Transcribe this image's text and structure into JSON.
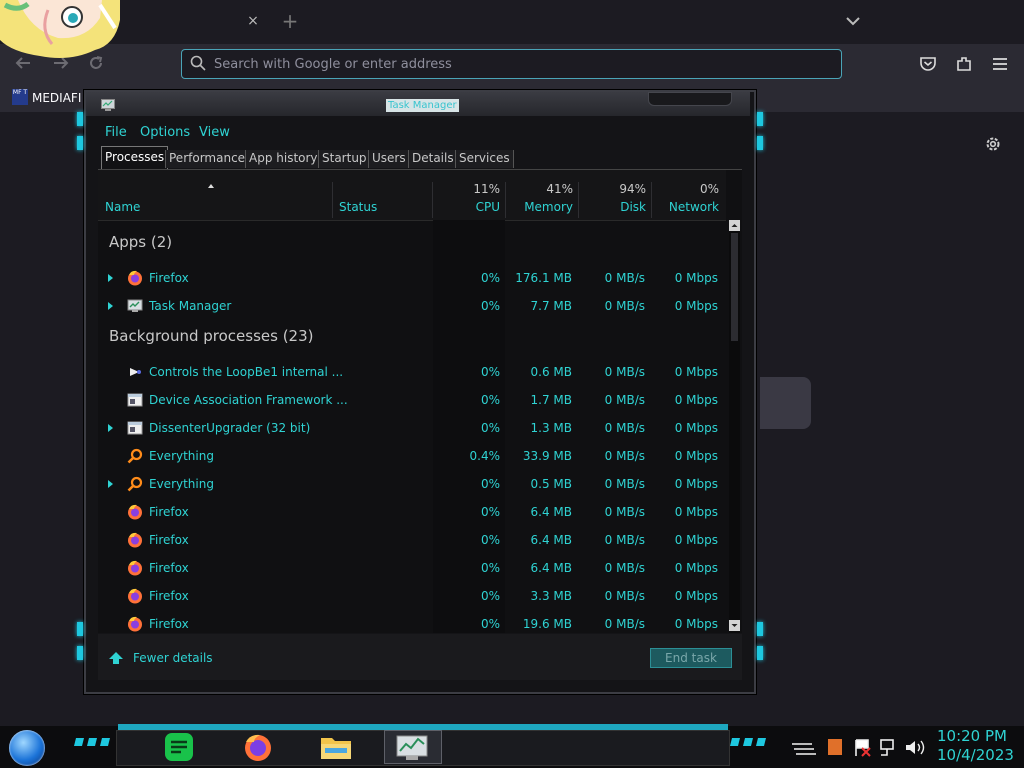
{
  "browser": {
    "tab_close_glyph": "×",
    "new_tab_glyph": "+",
    "url_placeholder": "Search with Google or enter address",
    "bookmark_label": "MEDIAFI",
    "bookmark_icon_text": "MF T"
  },
  "task_manager": {
    "title": "Task Manager",
    "menu": [
      "File",
      "Options",
      "View"
    ],
    "tabs": [
      "Processes",
      "Performance",
      "App history",
      "Startup",
      "Users",
      "Details",
      "Services"
    ],
    "active_tab": "Processes",
    "columns": {
      "name": "Name",
      "status": "Status",
      "cpu": {
        "label": "CPU",
        "pct": "11%"
      },
      "memory": {
        "label": "Memory",
        "pct": "41%"
      },
      "disk": {
        "label": "Disk",
        "pct": "94%"
      },
      "network": {
        "label": "Network",
        "pct": "0%"
      }
    },
    "groups": {
      "apps": "Apps (2)",
      "background": "Background processes (23)"
    },
    "rows": [
      {
        "name": "Firefox",
        "cpu": "0%",
        "memory": "176.1 MB",
        "disk": "0 MB/s",
        "network": "0 Mbps",
        "expandable": true,
        "icon": "firefox-icon"
      },
      {
        "name": "Task Manager",
        "cpu": "0%",
        "memory": "7.7 MB",
        "disk": "0 MB/s",
        "network": "0 Mbps",
        "expandable": true,
        "icon": "task-manager-icon"
      },
      {
        "name": "Controls the LoopBe1 internal ...",
        "cpu": "0%",
        "memory": "0.6 MB",
        "disk": "0 MB/s",
        "network": "0 Mbps",
        "expandable": false,
        "icon": "loopbe-icon"
      },
      {
        "name": "Device Association Framework ...",
        "cpu": "0%",
        "memory": "1.7 MB",
        "disk": "0 MB/s",
        "network": "0 Mbps",
        "expandable": false,
        "icon": "service-window-icon"
      },
      {
        "name": "DissenterUpgrader (32 bit)",
        "cpu": "0%",
        "memory": "1.3 MB",
        "disk": "0 MB/s",
        "network": "0 Mbps",
        "expandable": true,
        "icon": "service-window-icon"
      },
      {
        "name": "Everything",
        "cpu": "0.4%",
        "memory": "33.9 MB",
        "disk": "0 MB/s",
        "network": "0 Mbps",
        "expandable": false,
        "icon": "magnifier-icon"
      },
      {
        "name": "Everything",
        "cpu": "0%",
        "memory": "0.5 MB",
        "disk": "0 MB/s",
        "network": "0 Mbps",
        "expandable": true,
        "icon": "magnifier-icon"
      },
      {
        "name": "Firefox",
        "cpu": "0%",
        "memory": "6.4 MB",
        "disk": "0 MB/s",
        "network": "0 Mbps",
        "expandable": false,
        "icon": "firefox-icon"
      },
      {
        "name": "Firefox",
        "cpu": "0%",
        "memory": "6.4 MB",
        "disk": "0 MB/s",
        "network": "0 Mbps",
        "expandable": false,
        "icon": "firefox-icon"
      },
      {
        "name": "Firefox",
        "cpu": "0%",
        "memory": "6.4 MB",
        "disk": "0 MB/s",
        "network": "0 Mbps",
        "expandable": false,
        "icon": "firefox-icon"
      },
      {
        "name": "Firefox",
        "cpu": "0%",
        "memory": "3.3 MB",
        "disk": "0 MB/s",
        "network": "0 Mbps",
        "expandable": false,
        "icon": "firefox-icon"
      },
      {
        "name": "Firefox",
        "cpu": "0%",
        "memory": "19.6 MB",
        "disk": "0 MB/s",
        "network": "0 Mbps",
        "expandable": false,
        "icon": "firefox-icon"
      }
    ],
    "footer": {
      "fewer_details": "Fewer details",
      "end_task": "End task"
    }
  },
  "taskbar": {
    "time": "10:20 PM",
    "date": "10/4/2023",
    "accent_color": "#2fd3d3"
  }
}
